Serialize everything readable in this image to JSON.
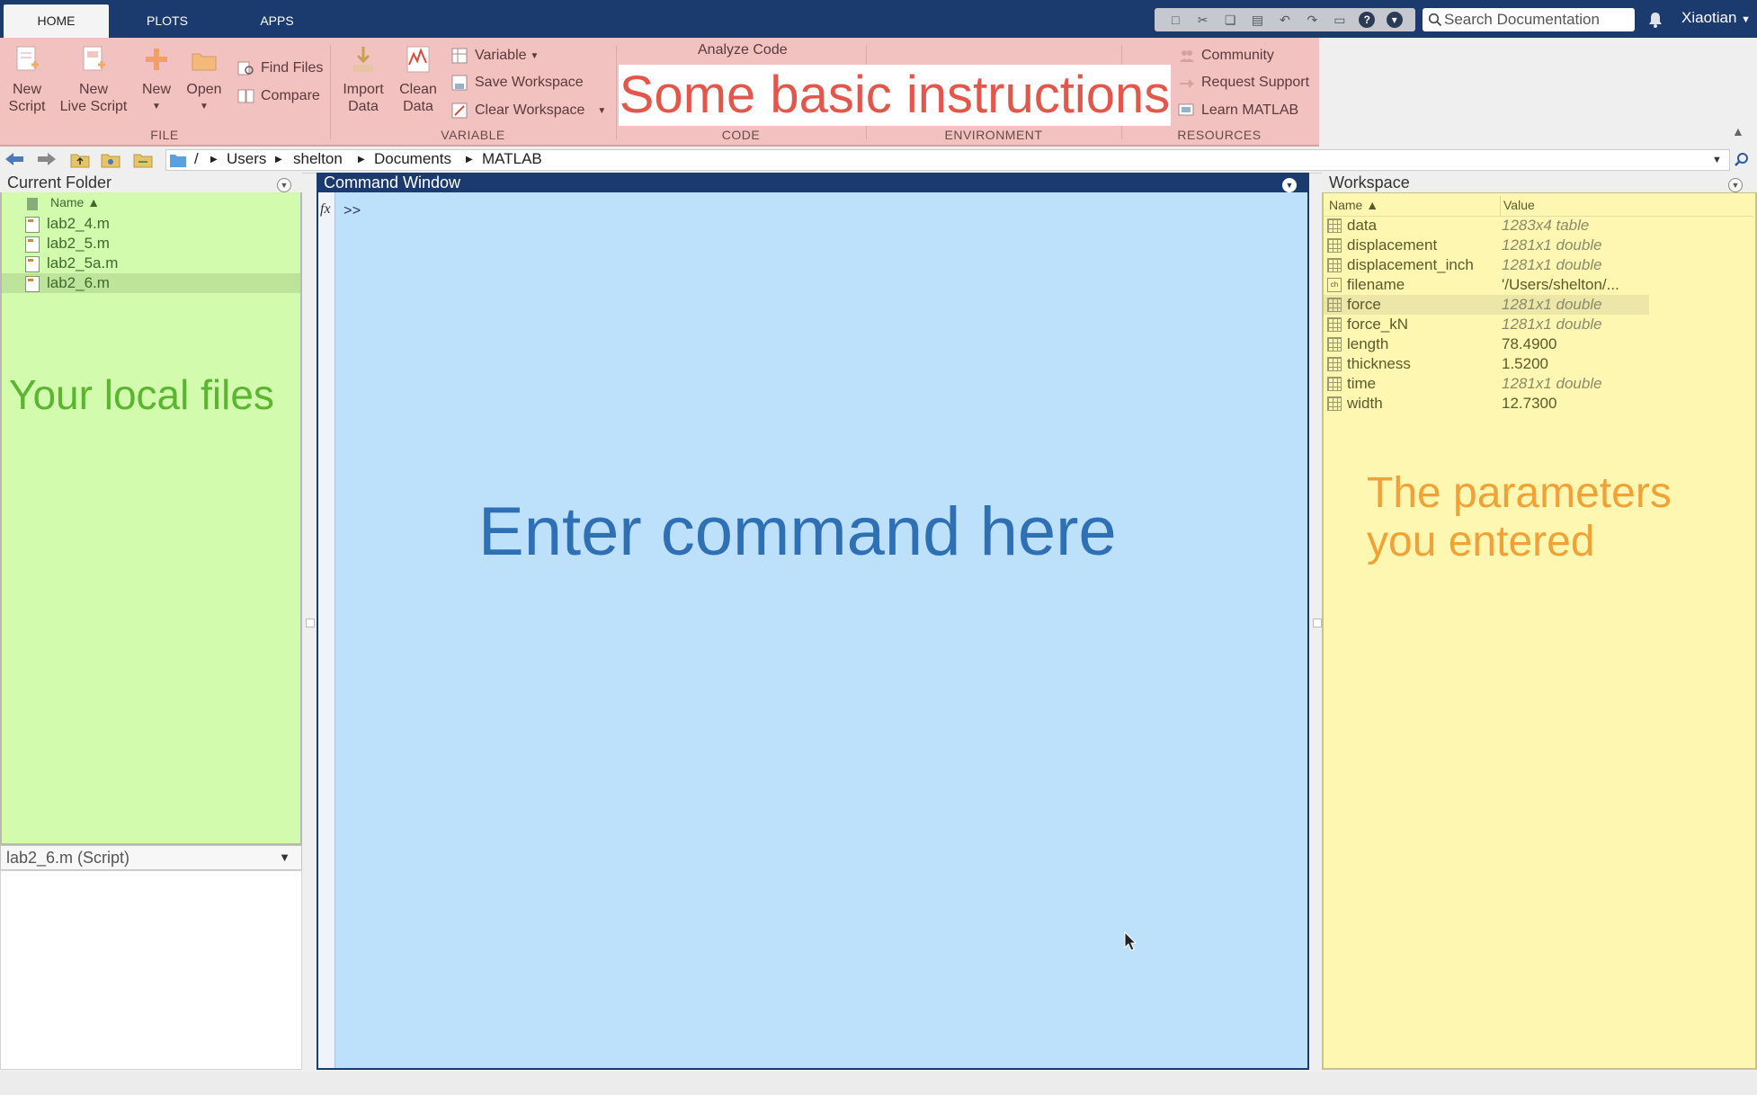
{
  "tabs": [
    {
      "label": "HOME",
      "active": true
    },
    {
      "label": "PLOTS",
      "active": false
    },
    {
      "label": "APPS",
      "active": false
    }
  ],
  "search": {
    "placeholder": "Search Documentation"
  },
  "user": {
    "name": "Xiaotian"
  },
  "ribbon": {
    "file": {
      "label": "FILE",
      "new_script": [
        "New",
        "Script"
      ],
      "new_live_script": [
        "New",
        "Live Script"
      ],
      "new": "New",
      "open": "Open",
      "find_files": "Find Files",
      "compare": "Compare"
    },
    "variable": {
      "label": "VARIABLE",
      "import_data": [
        "Import",
        "Data"
      ],
      "clean_data": [
        "Clean",
        "Data"
      ],
      "variable": "Variable",
      "save_workspace": "Save Workspace",
      "clear_workspace": "Clear Workspace"
    },
    "code": {
      "label": "CODE",
      "analyze_code": "Analyze Code"
    },
    "environment": {
      "label": "ENVIRONMENT"
    },
    "resources": {
      "label": "RESOURCES",
      "community": "Community",
      "request_support": "Request Support",
      "learn_matlab": "Learn MATLAB"
    }
  },
  "address": {
    "crumbs": [
      "/",
      "Users",
      "shelton",
      "Documents",
      "MATLAB"
    ]
  },
  "current_folder": {
    "title": "Current Folder",
    "column_name": "Name ▲",
    "files": [
      "lab2_4.m",
      "lab2_5.m",
      "lab2_5a.m",
      "lab2_6.m"
    ],
    "selected": "lab2_6.m",
    "details": "lab2_6.m  (Script)"
  },
  "command_window": {
    "title": "Command Window",
    "prompt": ">>",
    "fx": "fx"
  },
  "workspace": {
    "title": "Workspace",
    "col_name": "Name ▲",
    "col_value": "Value",
    "rows": [
      {
        "name": "data",
        "value": "1283x4 table",
        "italic": true
      },
      {
        "name": "displacement",
        "value": "1281x1 double",
        "italic": true
      },
      {
        "name": "displacement_inch",
        "value": "1281x1 double",
        "italic": true
      },
      {
        "name": "filename",
        "value": "'/Users/shelton/...",
        "italic": false
      },
      {
        "name": "force",
        "value": "1281x1 double",
        "italic": true
      },
      {
        "name": "force_kN",
        "value": "1281x1 double",
        "italic": true
      },
      {
        "name": "length",
        "value": "78.4900",
        "italic": false
      },
      {
        "name": "thickness",
        "value": "1.5200",
        "italic": false
      },
      {
        "name": "time",
        "value": "1281x1 double",
        "italic": true
      },
      {
        "name": "width",
        "value": "12.7300",
        "italic": false
      }
    ],
    "selected": "force"
  },
  "callouts": {
    "basic": "Some basic instructions",
    "local": "Your local files",
    "command": "Enter command here",
    "params_line1": "The parameters",
    "params_line2": "you entered"
  },
  "colors": {
    "title_bar": "#1b3b6e",
    "ribbon_highlight": "#f2c2c0",
    "folder_highlight": "#d2fbae",
    "command_highlight": "#bde0fb",
    "workspace_highlight": "#fef7b2",
    "callout_red": "#e2574c",
    "callout_green": "#5bb531",
    "callout_blue": "#2f6fb3",
    "callout_orange": "#f1a236"
  }
}
